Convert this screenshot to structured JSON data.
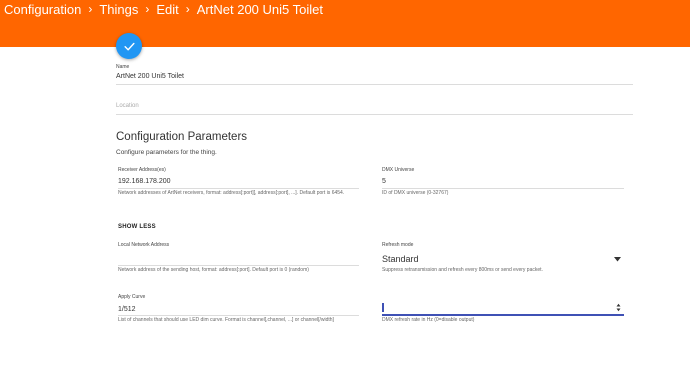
{
  "breadcrumb": {
    "items": [
      "Configuration",
      "Things",
      "Edit",
      "ArtNet 200 Uni5 Toilet"
    ],
    "separator": "›"
  },
  "colors": {
    "header": "#ff6600",
    "fab": "#2196f3",
    "accent": "#3f51b5"
  },
  "fab_icon": "check-icon",
  "name_field": {
    "label": "Name",
    "value": "ArtNet 200 Uni5 Toilet"
  },
  "location_field": {
    "placeholder": "Location"
  },
  "config": {
    "title": "Configuration Parameters",
    "description": "Configure parameters for the thing."
  },
  "receiver": {
    "label": "Receiver Address(es)",
    "value": "192.168.178.200",
    "hint": "Network addresses of ArtNet receivers, format: address[:port][, address[:port], ...]. Default port is 6454."
  },
  "dmx_universe": {
    "label": "DMX Universe",
    "value": "5",
    "hint": "ID of DMX universe (0-32767)"
  },
  "show_less": "SHOW LESS",
  "local_network": {
    "label": "Local Network Address",
    "value": "",
    "hint": "Network address of the sending host, format: address[:port]. Default port is 0 (random)"
  },
  "refresh_mode": {
    "label": "Refresh mode",
    "value": "Standard",
    "hint": "Suppress retransmission and refresh every 800ms or send every packet."
  },
  "apply_curve": {
    "label": "Apply Curve",
    "value": "1/512",
    "hint": "List of channels that should use LED dim curve. Format is channel[,channel, ...] or channel[/width]"
  },
  "refresh_rate": {
    "value": "",
    "hint": "DMX refresh rate in Hz (0=disable output)"
  }
}
